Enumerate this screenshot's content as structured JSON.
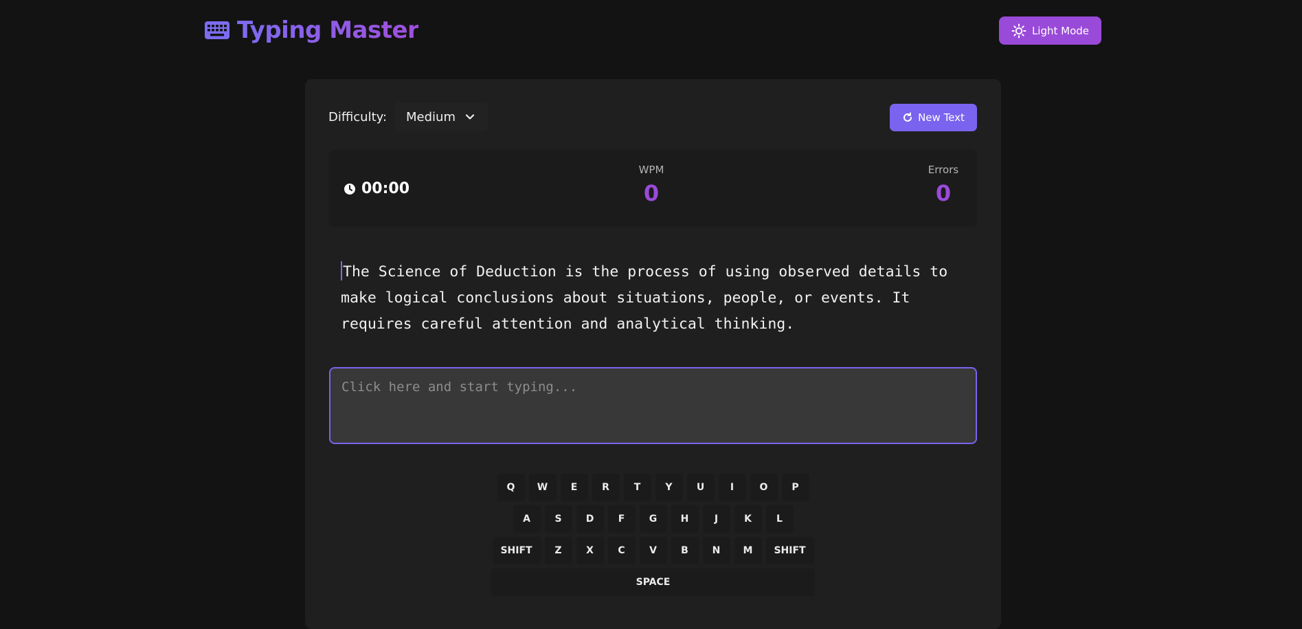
{
  "header": {
    "title": "Typing Master",
    "theme_button": "Light Mode",
    "brand_icon": "keyboard-icon",
    "theme_icon": "sun-icon"
  },
  "controls": {
    "difficulty_label": "Difficulty:",
    "difficulty_value": "Medium",
    "new_text_label": "New Text",
    "new_text_icon": "refresh-icon"
  },
  "stats": {
    "timer": "00:00",
    "timer_icon": "clock-icon",
    "wpm_label": "WPM",
    "wpm_value": "0",
    "errors_label": "Errors",
    "errors_value": "0"
  },
  "passage": {
    "text": "The Science of Deduction is the process of using observed details to make logical conclusions about situations, people, or events. It requires careful attention and analytical thinking."
  },
  "input": {
    "placeholder": "Click here and start typing...",
    "value": ""
  },
  "keyboard": {
    "row1": [
      "Q",
      "W",
      "E",
      "R",
      "T",
      "Y",
      "U",
      "I",
      "O",
      "P"
    ],
    "row2": [
      "A",
      "S",
      "D",
      "F",
      "G",
      "H",
      "J",
      "K",
      "L"
    ],
    "row3": [
      "SHIFT",
      "Z",
      "X",
      "C",
      "V",
      "B",
      "N",
      "M",
      "SHIFT"
    ],
    "row4": [
      "SPACE"
    ]
  },
  "colors": {
    "background": "#131313",
    "card": "#1f1f1f",
    "accent_purple": "#9a4ad9",
    "accent_violet": "#7a63ee"
  }
}
